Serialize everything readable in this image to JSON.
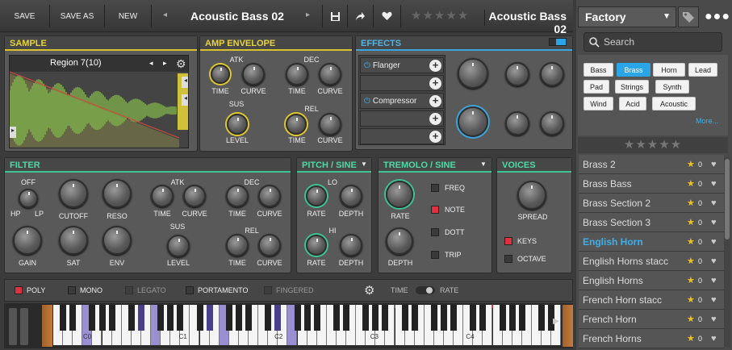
{
  "toolbar": {
    "save": "SAVE",
    "save_as": "SAVE AS",
    "new": "NEW",
    "preset": "Acoustic Bass 02",
    "preset_right": "Acoustic Bass 02",
    "stars": "★★★★★"
  },
  "browser": {
    "library": "Factory",
    "search_placeholder": "Search",
    "more": "More...",
    "stars": "★★★★★",
    "tags": [
      "Bass",
      "Brass",
      "Horn",
      "Lead",
      "Pad",
      "Strings",
      "Synth",
      "Wind",
      "Acid",
      "Acoustic"
    ],
    "selected_tag": "Brass",
    "items": [
      {
        "name": "Brass 2",
        "count": "0"
      },
      {
        "name": "Brass Bass",
        "count": "0"
      },
      {
        "name": "Brass Section 2",
        "count": "0"
      },
      {
        "name": "Brass Section 3",
        "count": "0"
      },
      {
        "name": "English Horn",
        "count": "0"
      },
      {
        "name": "English Horns stacc",
        "count": "0"
      },
      {
        "name": "English Horns",
        "count": "0"
      },
      {
        "name": "French Horn stacc",
        "count": "0"
      },
      {
        "name": "French Horn",
        "count": "0"
      },
      {
        "name": "French Horns",
        "count": "0"
      }
    ],
    "selected_item": "English Horn"
  },
  "sample": {
    "title": "SAMPLE",
    "region": "Region 7(10)"
  },
  "amp": {
    "title": "AMP ENVELOPE",
    "atk": "ATK",
    "dec": "DEC",
    "sus": "SUS",
    "rel": "REL",
    "time": "TIME",
    "curve": "CURVE",
    "level": "LEVEL"
  },
  "effects": {
    "title": "EFFECTS",
    "slot1": "Flanger",
    "slot2": "Compressor"
  },
  "filter": {
    "title": "FILTER",
    "off": "OFF",
    "hp": "HP",
    "lp": "LP",
    "cutoff": "CUTOFF",
    "reso": "RESO",
    "gain": "GAIN",
    "sat": "SAT",
    "env": "ENV",
    "atk": "ATK",
    "dec": "DEC",
    "sus": "SUS",
    "rel": "REL",
    "time": "TIME",
    "curve": "CURVE",
    "level": "LEVEL"
  },
  "pitch": {
    "title": "PITCH / SINE",
    "lo": "LO",
    "hi": "HI",
    "rate": "RATE",
    "depth": "DEPTH"
  },
  "tremolo": {
    "title": "TREMOLO / SINE",
    "rate": "RATE",
    "depth": "DEPTH",
    "freq": "FREQ",
    "note": "NOTE",
    "dott": "DOTT",
    "trip": "TRIP"
  },
  "voices": {
    "title": "VOICES",
    "spread": "SPREAD",
    "keys": "KEYS",
    "octave": "OCTAVE"
  },
  "play": {
    "poly": "POLY",
    "mono": "MONO",
    "legato": "LEGATO",
    "portamento": "PORTAMENTO",
    "fingered": "FINGERED",
    "time": "TIME",
    "rate": "RATE"
  },
  "keyboard": {
    "octaves": [
      "C0",
      "C1",
      "C2",
      "C3",
      "C4"
    ]
  }
}
